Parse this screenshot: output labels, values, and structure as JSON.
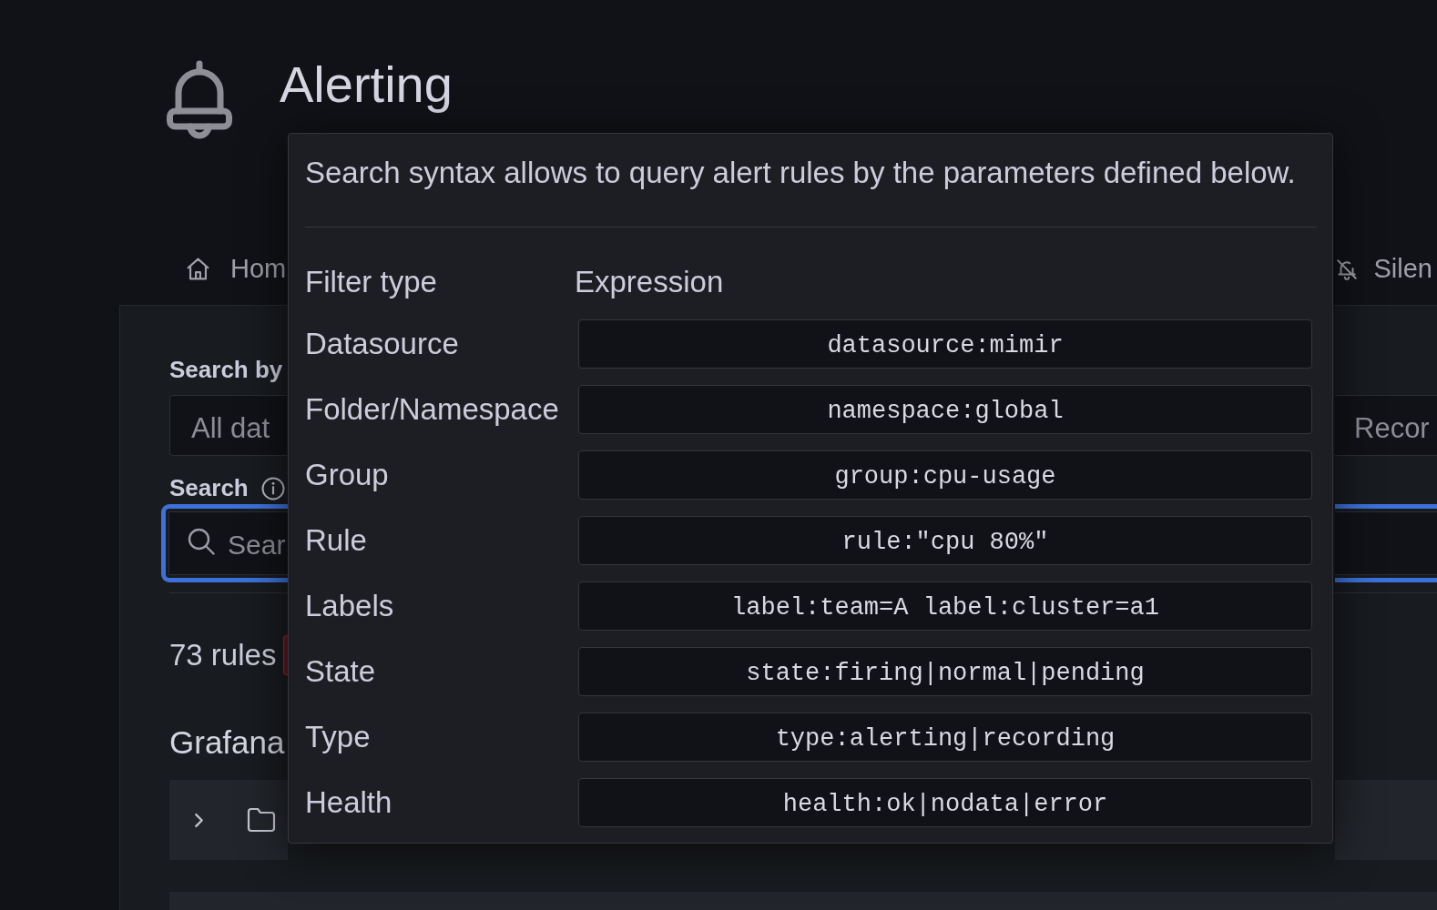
{
  "header": {
    "title": "Alerting"
  },
  "tabs": [
    {
      "label": "Hom",
      "selected": false
    },
    {
      "label": "Silen",
      "selected": false
    }
  ],
  "filters": {
    "datasource_label": "Search by",
    "datasource_field": {
      "placeholder": "All dat"
    },
    "rule_type_option": {
      "label": "Recor",
      "selected": false
    },
    "search_label": "Search",
    "search_field": {
      "placeholder": "Sear",
      "focused": true
    }
  },
  "rules_summary": {
    "count": "73 rules"
  },
  "rule_list": {
    "title": "Grafana",
    "rows": [
      {
        "expanded": false
      }
    ]
  },
  "syntax_help": {
    "intro": "Search syntax allows to query alert rules by the parameters defined below.",
    "columns": [
      "Filter type",
      "Expression"
    ],
    "rows": [
      {
        "filter_type": "Datasource",
        "expression": "datasource:mimir"
      },
      {
        "filter_type": "Folder/Namespace",
        "expression": "namespace:global"
      },
      {
        "filter_type": "Group",
        "expression": "group:cpu-usage"
      },
      {
        "filter_type": "Rule",
        "expression": "rule:\"cpu 80%\""
      },
      {
        "filter_type": "Labels",
        "expression": "label:team=A label:cluster=a1"
      },
      {
        "filter_type": "State",
        "expression": "state:firing|normal|pending"
      },
      {
        "filter_type": "Type",
        "expression": "type:alerting|recording"
      },
      {
        "filter_type": "Health",
        "expression": "health:ok|nodata|error"
      }
    ]
  }
}
